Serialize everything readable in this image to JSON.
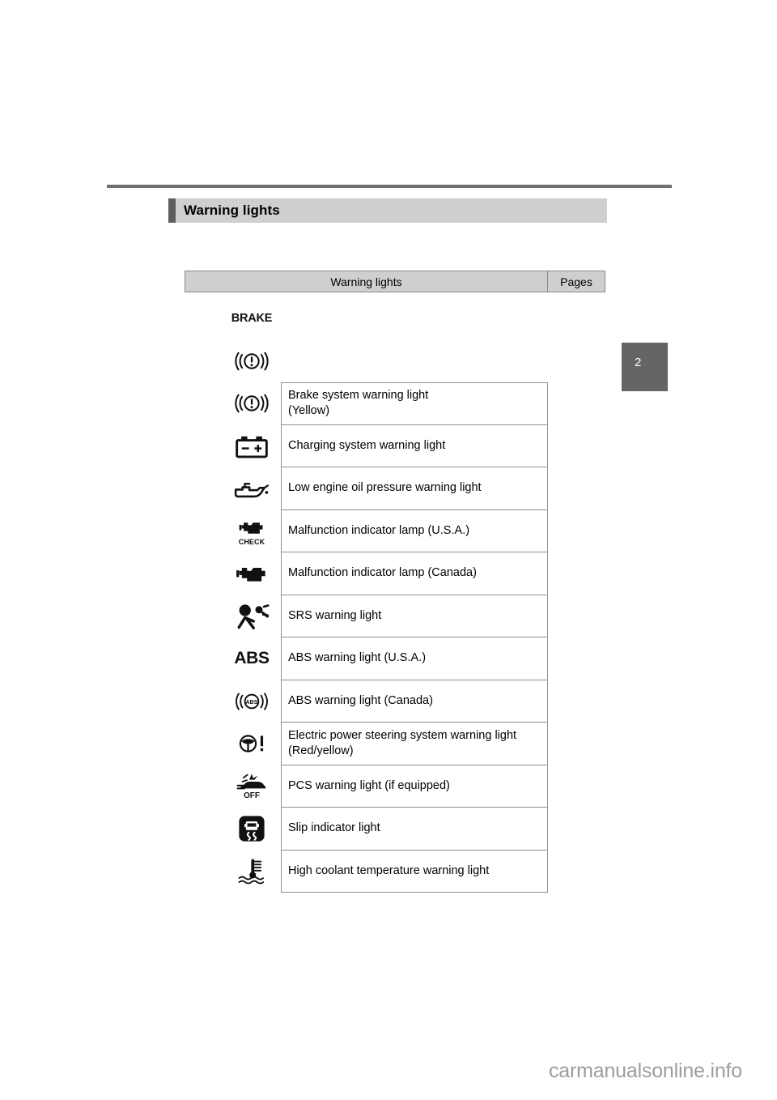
{
  "page": {
    "section_title": "Warning lights",
    "chapter_tab": "2",
    "watermark": "carmanualsonline.info"
  },
  "table": {
    "header": {
      "col_main": "Warning lights",
      "col_pages": "Pages"
    },
    "rows": [
      {
        "icon": "brake-word-icon",
        "icon_label": "BRAKE",
        "description": "",
        "sub_description": "",
        "has_text_cell": false
      },
      {
        "icon": "brake-system-circle-icon",
        "icon_label": "",
        "description": "",
        "sub_description": "",
        "has_text_cell": false
      },
      {
        "icon": "brake-system-circle-icon",
        "icon_label": "",
        "description": "Brake system warning light",
        "sub_description": "(Yellow)",
        "has_text_cell": true
      },
      {
        "icon": "battery-icon",
        "icon_label": "",
        "description": "Charging system warning light",
        "sub_description": "",
        "has_text_cell": true
      },
      {
        "icon": "oil-can-icon",
        "icon_label": "",
        "description": "Low engine oil pressure warning light",
        "sub_description": "",
        "has_text_cell": true
      },
      {
        "icon": "check-engine-check-icon",
        "icon_label": "CHECK",
        "description": "Malfunction indicator lamp (U.S.A.)",
        "sub_description": "",
        "has_text_cell": true
      },
      {
        "icon": "check-engine-icon",
        "icon_label": "",
        "description": "Malfunction indicator lamp (Canada)",
        "sub_description": "",
        "has_text_cell": true
      },
      {
        "icon": "srs-airbag-icon",
        "icon_label": "",
        "description": "SRS warning light",
        "sub_description": "",
        "has_text_cell": true
      },
      {
        "icon": "abs-word-icon",
        "icon_label": "ABS",
        "description": "ABS warning light (U.S.A.)",
        "sub_description": "",
        "has_text_cell": true
      },
      {
        "icon": "abs-circle-icon",
        "icon_label": "ABS",
        "description": "ABS warning light (Canada)",
        "sub_description": "",
        "has_text_cell": true
      },
      {
        "icon": "steering-wheel-exclamation-icon",
        "icon_label": "",
        "description": "Electric power steering system warning light",
        "sub_description": "(Red/yellow)",
        "has_text_cell": true
      },
      {
        "icon": "pcs-off-icon",
        "icon_label": "OFF",
        "description": "PCS warning light (if equipped)",
        "sub_description": "",
        "has_text_cell": true
      },
      {
        "icon": "slip-indicator-icon",
        "icon_label": "",
        "description": "Slip indicator light",
        "sub_description": "",
        "has_text_cell": true
      },
      {
        "icon": "coolant-temperature-icon",
        "icon_label": "",
        "description": "High coolant temperature warning light",
        "sub_description": "",
        "has_text_cell": true
      }
    ]
  },
  "colors": {
    "title_bar_bg": "#cfcfcf",
    "title_accent": "#5e5e5e",
    "rule": "#6f6f6f",
    "chapter_tab_bg": "#656565",
    "border": "#8f8f8f",
    "watermark": "#9d9d9d"
  }
}
